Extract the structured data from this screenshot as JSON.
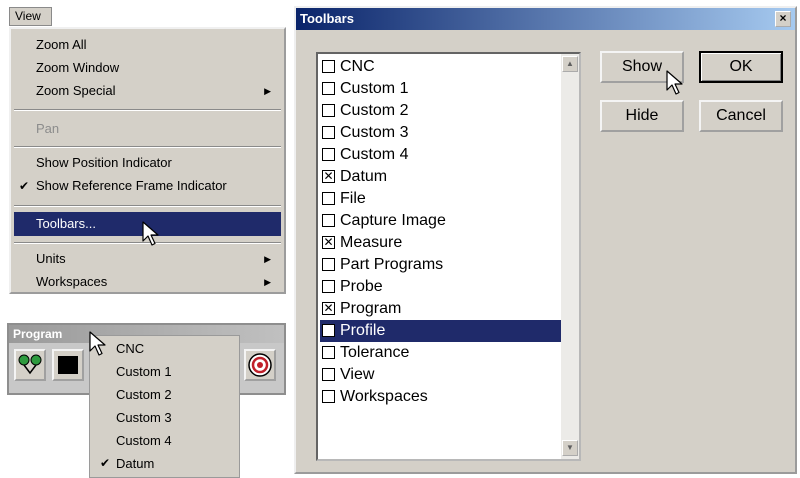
{
  "view_menu": {
    "tab_label": "View",
    "items": {
      "zoom_all": "Zoom All",
      "zoom_window": "Zoom Window",
      "zoom_special": "Zoom Special",
      "pan": "Pan",
      "show_position": "Show Position Indicator",
      "show_reference": "Show Reference Frame Indicator",
      "toolbars": "Toolbars...",
      "units": "Units",
      "workspaces": "Workspaces"
    },
    "checked_item": "Show Reference Frame Indicator",
    "selected_item": "Toolbars..."
  },
  "program_toolbar": {
    "title": "Program",
    "menu_items": [
      "CNC",
      "Custom 1",
      "Custom 2",
      "Custom 3",
      "Custom 4",
      "Datum"
    ],
    "checked_item": "Datum"
  },
  "toolbars_dialog": {
    "title": "Toolbars",
    "close_glyph": "×",
    "items": [
      {
        "label": "CNC",
        "checked": false
      },
      {
        "label": "Custom 1",
        "checked": false
      },
      {
        "label": "Custom 2",
        "checked": false
      },
      {
        "label": "Custom 3",
        "checked": false
      },
      {
        "label": "Custom 4",
        "checked": false
      },
      {
        "label": "Datum",
        "checked": true
      },
      {
        "label": "File",
        "checked": false
      },
      {
        "label": "Capture Image",
        "checked": false
      },
      {
        "label": "Measure",
        "checked": true
      },
      {
        "label": "Part Programs",
        "checked": false
      },
      {
        "label": "Probe",
        "checked": false
      },
      {
        "label": "Program",
        "checked": true
      },
      {
        "label": "Profile",
        "checked": false,
        "selected": true
      },
      {
        "label": "Tolerance",
        "checked": false
      },
      {
        "label": "View",
        "checked": false
      },
      {
        "label": "Workspaces",
        "checked": false
      }
    ],
    "buttons": {
      "show": "Show",
      "ok": "OK",
      "hide": "Hide",
      "cancel": "Cancel"
    }
  },
  "colors": {
    "selection": "#1f2a6a",
    "dialog_bg": "#d4d0c8",
    "title_bar": "#0a246a"
  }
}
